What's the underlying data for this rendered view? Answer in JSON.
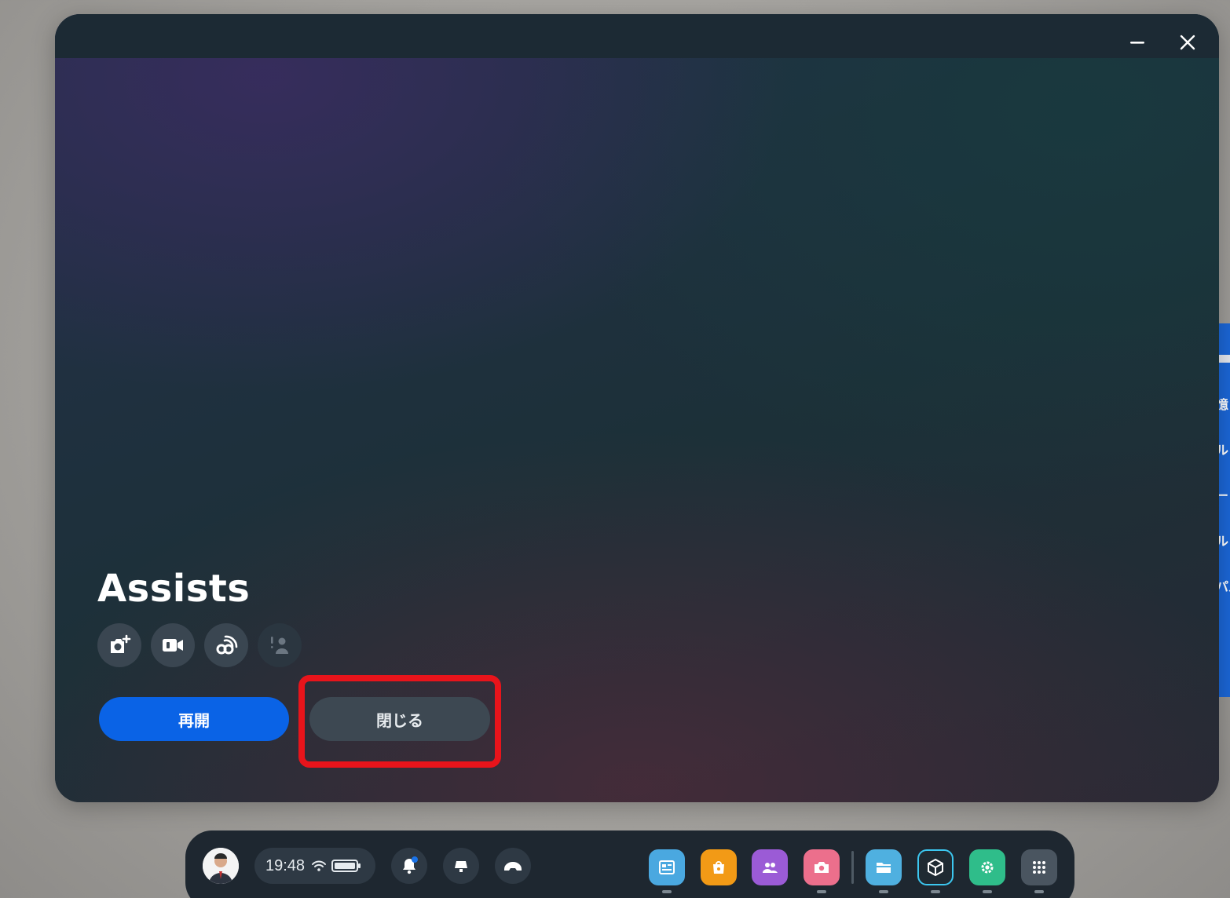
{
  "window": {
    "app_title": "Assists",
    "minimize_icon": "minimize-icon",
    "close_icon": "close-icon"
  },
  "permissions": [
    {
      "name": "camera-add-icon",
      "enabled": true
    },
    {
      "name": "video-icon",
      "enabled": true
    },
    {
      "name": "wireless-icon",
      "enabled": true
    },
    {
      "name": "person-icon",
      "enabled": false
    }
  ],
  "buttons": {
    "resume_label": "再開",
    "close_label": "閉じる"
  },
  "background_window": {
    "fragments": [
      "記憶",
      "ール",
      "イー",
      "パル",
      "ンパル"
    ]
  },
  "taskbar": {
    "time": "19:48",
    "quick_buttons": [
      "bell-icon",
      "lamp-icon",
      "headset-icon"
    ],
    "notification_badge_color": "#1a73e8",
    "apps": [
      {
        "name": "app-browser",
        "color": "#4aa8e0"
      },
      {
        "name": "app-store",
        "color": "#f29a16"
      },
      {
        "name": "app-people",
        "color": "#9b5bd6"
      },
      {
        "name": "app-camera",
        "color": "#ec6f8c"
      },
      {
        "name": "app-files",
        "color": "#4fb0e0"
      },
      {
        "name": "app-unity",
        "color": "#1f2a32"
      },
      {
        "name": "app-settings",
        "color": "#2fbd8a"
      },
      {
        "name": "app-grid",
        "color": "#4a5560"
      }
    ]
  },
  "colors": {
    "accent": "#0a63e6",
    "highlight": "#e8141b"
  }
}
